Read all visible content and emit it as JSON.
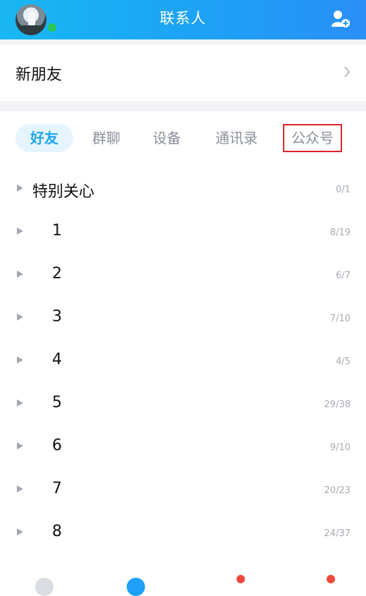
{
  "header": {
    "title": "联系人",
    "accent": "#1da0f5",
    "avatar_icon": "profile-avatar",
    "status_icon": "online-status-dot",
    "add_icon": "add-contact-icon"
  },
  "new_friends": {
    "label": "新朋友",
    "icon": "chevron-right-icon"
  },
  "tabs": [
    {
      "label": "好友",
      "active": true
    },
    {
      "label": "群聊"
    },
    {
      "label": "设备"
    },
    {
      "label": "通讯录"
    },
    {
      "label": "公众号",
      "highlighted": true
    }
  ],
  "groups": [
    {
      "name": "特别关心",
      "count": "0/1"
    },
    {
      "name": "1",
      "count": "8/19"
    },
    {
      "name": "2",
      "count": "6/7"
    },
    {
      "name": "3",
      "count": "7/10"
    },
    {
      "name": "4",
      "count": "4/5"
    },
    {
      "name": "5",
      "count": "29/38"
    },
    {
      "name": "6",
      "count": "9/10"
    },
    {
      "name": "7",
      "count": "20/23"
    },
    {
      "name": "8",
      "count": "24/37"
    }
  ]
}
